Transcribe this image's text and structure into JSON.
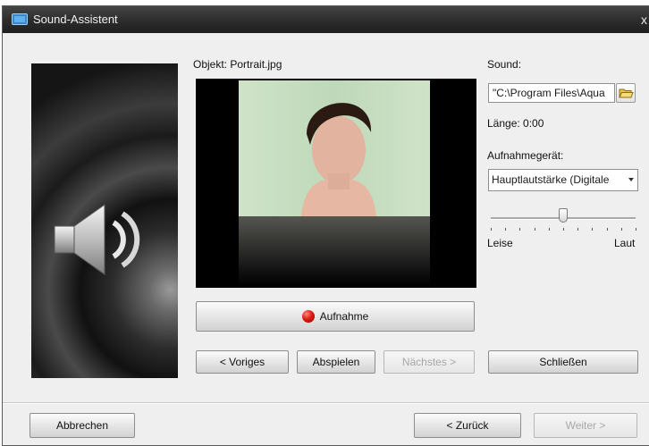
{
  "window": {
    "title": "Sound-Assistent",
    "close": "x"
  },
  "object": {
    "label": "Objekt: Portrait.jpg"
  },
  "sound": {
    "label": "Sound:",
    "path": "\"C:\\Program Files\\Aqua",
    "length": "Länge: 0:00"
  },
  "device": {
    "label": "Aufnahmegerät:",
    "selected": "Hauptlautstärke (Digitale"
  },
  "volume": {
    "min_label": "Leise",
    "max_label": "Laut",
    "level_fraction": 0.5
  },
  "buttons": {
    "record": "Aufnahme",
    "prev": "< Voriges",
    "play": "Abspielen",
    "next": "Nächstes >",
    "close": "Schließen",
    "cancel": "Abbrechen",
    "back": "< Zurück",
    "forward": "Weiter >"
  },
  "icons": {
    "title": "sound-wizard-icon",
    "folder": "folder-open-icon",
    "speaker": "speaker-icon",
    "record": "record-dot-icon"
  }
}
